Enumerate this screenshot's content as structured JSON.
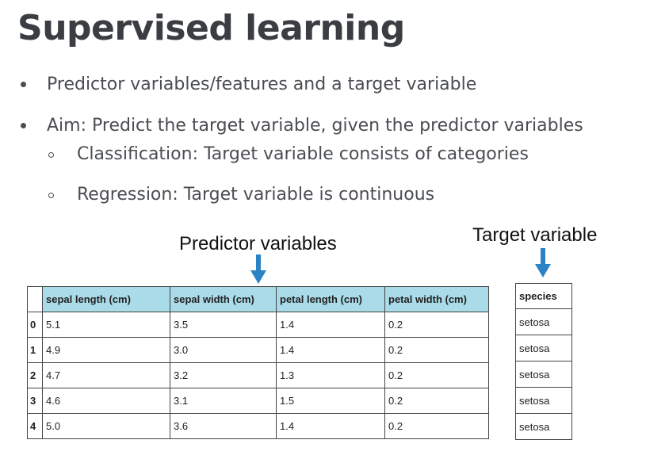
{
  "slide": {
    "title": "Supervised learning",
    "bullets": [
      "Predictor variables/features and a target variable",
      "Aim: Predict the target variable, given the predictor variables"
    ],
    "sub_bullets": [
      "Classification: Target variable consists of categories",
      "Regression: Target variable is continuous"
    ]
  },
  "labels": {
    "predictor": "Predictor variables",
    "target": "Target variable"
  },
  "colors": {
    "arrow": "#2a83c5",
    "header_highlight": "#a9dbe8"
  },
  "features_table": {
    "headers": [
      "sepal length (cm)",
      "sepal width (cm)",
      "petal length (cm)",
      "petal width (cm)"
    ],
    "rows": [
      {
        "index": "0",
        "values": [
          "5.1",
          "3.5",
          "1.4",
          "0.2"
        ]
      },
      {
        "index": "1",
        "values": [
          "4.9",
          "3.0",
          "1.4",
          "0.2"
        ]
      },
      {
        "index": "2",
        "values": [
          "4.7",
          "3.2",
          "1.3",
          "0.2"
        ]
      },
      {
        "index": "3",
        "values": [
          "4.6",
          "3.1",
          "1.5",
          "0.2"
        ]
      },
      {
        "index": "4",
        "values": [
          "5.0",
          "3.6",
          "1.4",
          "0.2"
        ]
      }
    ]
  },
  "target_table": {
    "header": "species",
    "rows": [
      "setosa",
      "setosa",
      "setosa",
      "setosa",
      "setosa"
    ]
  }
}
